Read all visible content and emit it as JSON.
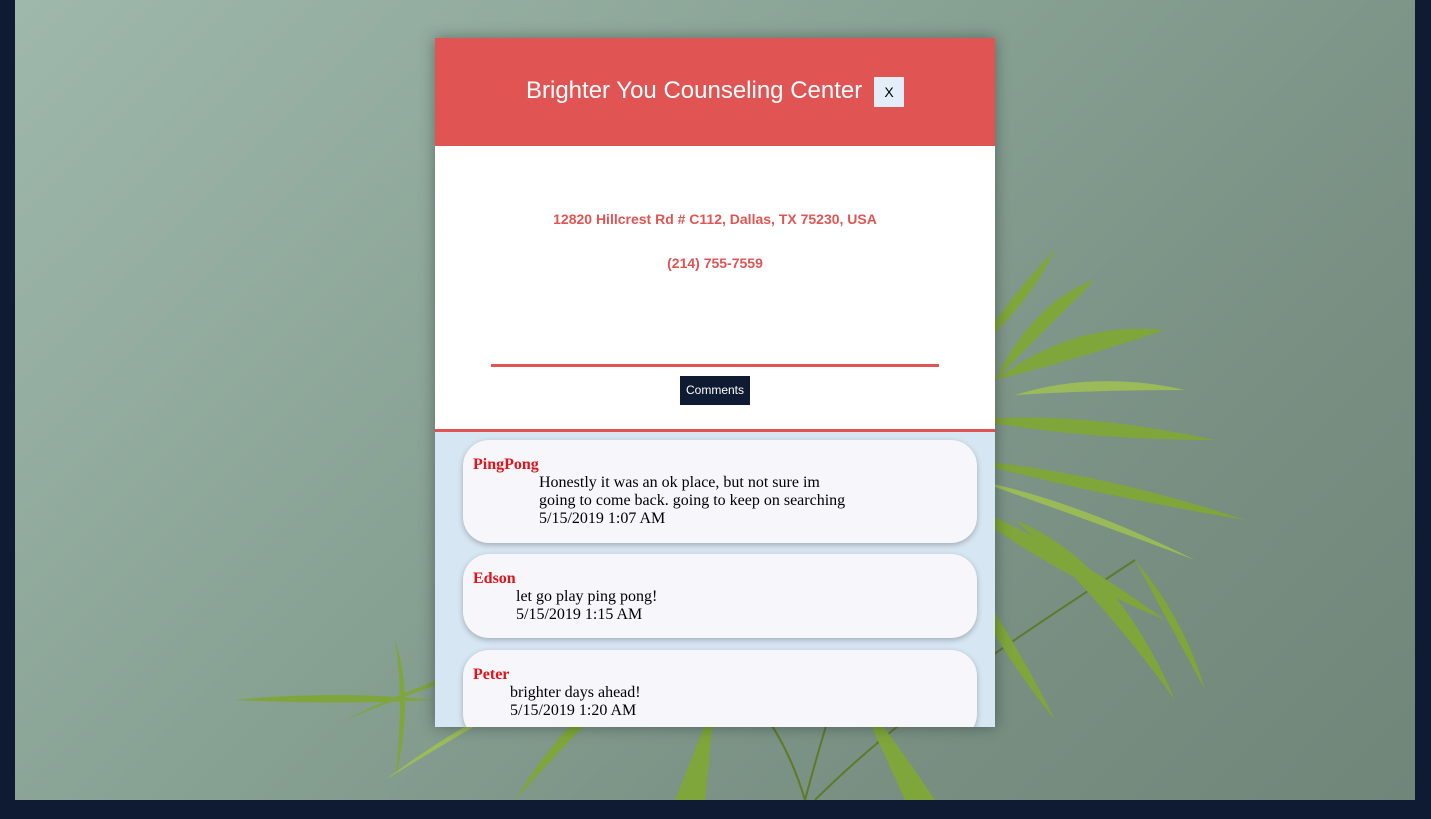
{
  "modal": {
    "title": "Brighter You Counseling Center",
    "close_label": "X",
    "address": "12820 Hillcrest Rd # C112, Dallas, TX 75230, USA",
    "phone": "(214) 755-7559",
    "comments_button": "Comments"
  },
  "comments": [
    {
      "author": "PingPong",
      "text": "Honestly it was an ok place, but not sure im going to come back. going to keep on searching",
      "date": "5/15/2019 1:07 AM"
    },
    {
      "author": "Edson",
      "text": "let go play ping pong!",
      "date": "5/15/2019 1:15 AM"
    },
    {
      "author": "Peter",
      "text": "brighter days ahead!",
      "date": "5/15/2019 1:20 AM"
    }
  ],
  "colors": {
    "accent": "#e05553",
    "navy": "#0f1a33",
    "author": "#e0141b",
    "comments_bg": "#d6e6f2"
  },
  "background_image": "plant-leaves-photo"
}
